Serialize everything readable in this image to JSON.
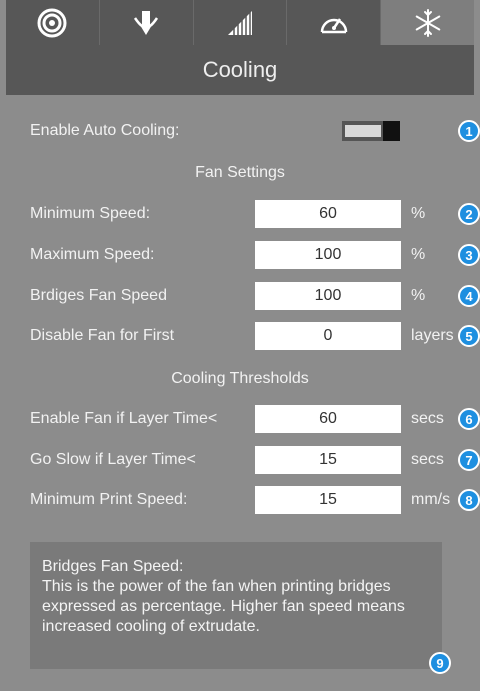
{
  "tabs": [
    {
      "icon": "spiral-icon",
      "active": false
    },
    {
      "icon": "nozzle-icon",
      "active": false
    },
    {
      "icon": "infill-icon",
      "active": false
    },
    {
      "icon": "speedometer-icon",
      "active": false
    },
    {
      "icon": "snowflake-icon",
      "active": true
    }
  ],
  "header": {
    "title": "Cooling"
  },
  "auto_cooling": {
    "label": "Enable Auto Cooling:",
    "enabled": true
  },
  "fan_settings": {
    "title": "Fan Settings",
    "min_speed": {
      "label": "Minimum Speed:",
      "value": "60",
      "unit": "%"
    },
    "max_speed": {
      "label": "Maximum Speed:",
      "value": "100",
      "unit": "%"
    },
    "bridges_speed": {
      "label": "Brdiges Fan Speed",
      "value": "100",
      "unit": "%"
    },
    "disable_first": {
      "label": "Disable Fan for First",
      "value": "0",
      "unit": "layers"
    }
  },
  "thresholds": {
    "title": "Cooling Thresholds",
    "enable_fan": {
      "label": "Enable Fan if Layer Time<",
      "value": "60",
      "unit": "secs"
    },
    "go_slow": {
      "label": "Go Slow if Layer Time<",
      "value": "15",
      "unit": "secs"
    },
    "min_print_speed": {
      "label": "Minimum Print Speed:",
      "value": "15",
      "unit": "mm/s"
    }
  },
  "help": {
    "title": "Bridges Fan Speed:",
    "body": "This is the power of the fan when printing bridges expressed as percentage. Higher fan speed means increased cooling of extrudate."
  },
  "badges": [
    "1",
    "2",
    "3",
    "4",
    "5",
    "6",
    "7",
    "8",
    "9"
  ],
  "colors": {
    "badge": "#1e8fe0",
    "panel": "#8c8c8c",
    "header": "#575757",
    "active_tab": "#7e7e7e"
  }
}
